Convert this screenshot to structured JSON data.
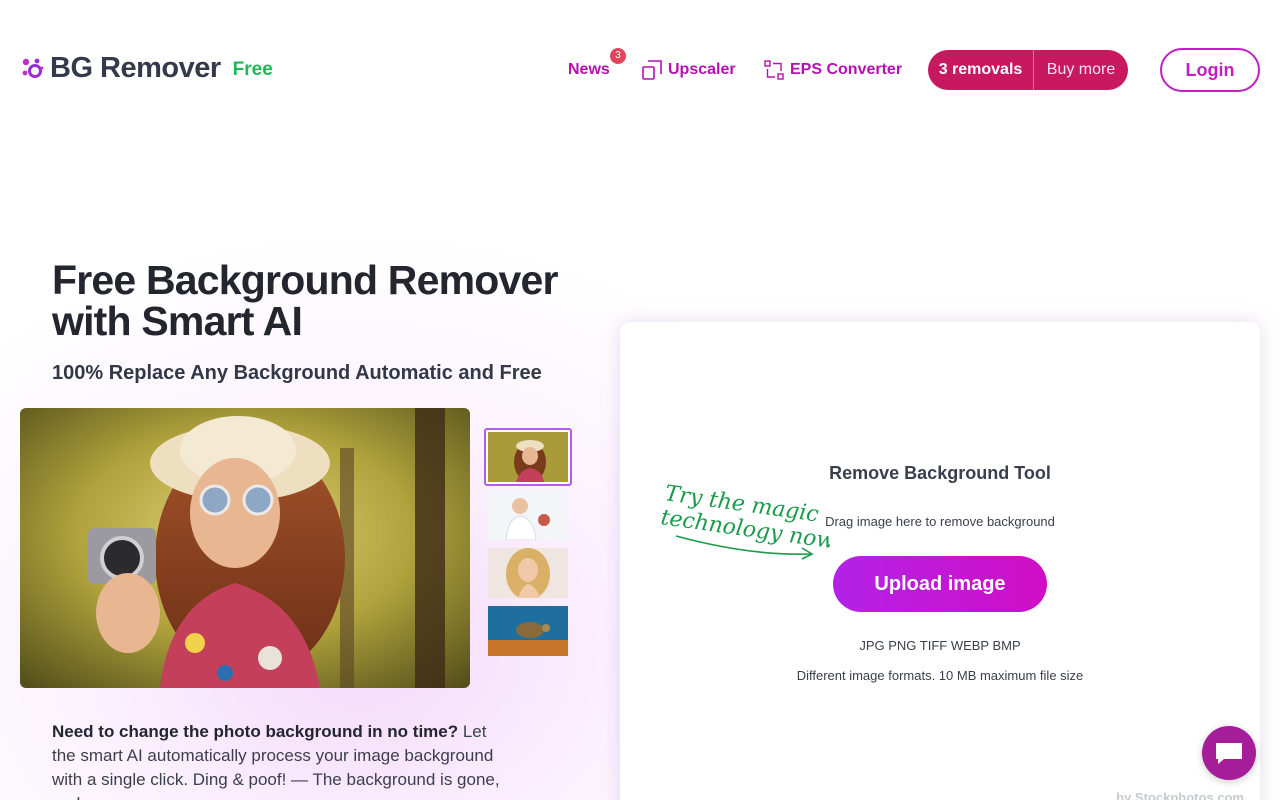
{
  "header": {
    "logo_text": "BG Remover",
    "logo_free": "Free",
    "nav": {
      "news_label": "News",
      "news_badge": "3",
      "upscaler_label": "Upscaler",
      "eps_label": "EPS Converter"
    },
    "removals_count": "3 removals",
    "buy_more": "Buy more",
    "login": "Login"
  },
  "hero": {
    "title": "Free Background Remover with Smart AI",
    "subtitle": "100% Replace Any Background Automatic and Free",
    "description_bold": "Need to change the photo background in no time?",
    "description": " Let the smart AI automatically process your image background with a single click. Ding & poof! — The background is gone, and you"
  },
  "tool": {
    "title": "Remove Background Tool",
    "drag_text": "Drag image here to remove background",
    "upload_button": "Upload image",
    "formats": "JPG PNG TIFF WEBP BMP",
    "limits": "Different image formats. 10 MB maximum file size",
    "magic_line1": "Try the magic",
    "magic_line2": "technology now!",
    "credit": "by Stockphotos.com"
  },
  "icons": {
    "logo": "sparkle-logo-icon",
    "upscaler": "upscale-icon",
    "eps": "vector-convert-icon",
    "chat": "chat-bubble-icon"
  },
  "colors": {
    "brand_magenta": "#b511ae",
    "removals_bg": "#c8185f",
    "free_green": "#1db954",
    "upload_gradient_start": "#b322e8",
    "upload_gradient_end": "#d00ec4"
  }
}
